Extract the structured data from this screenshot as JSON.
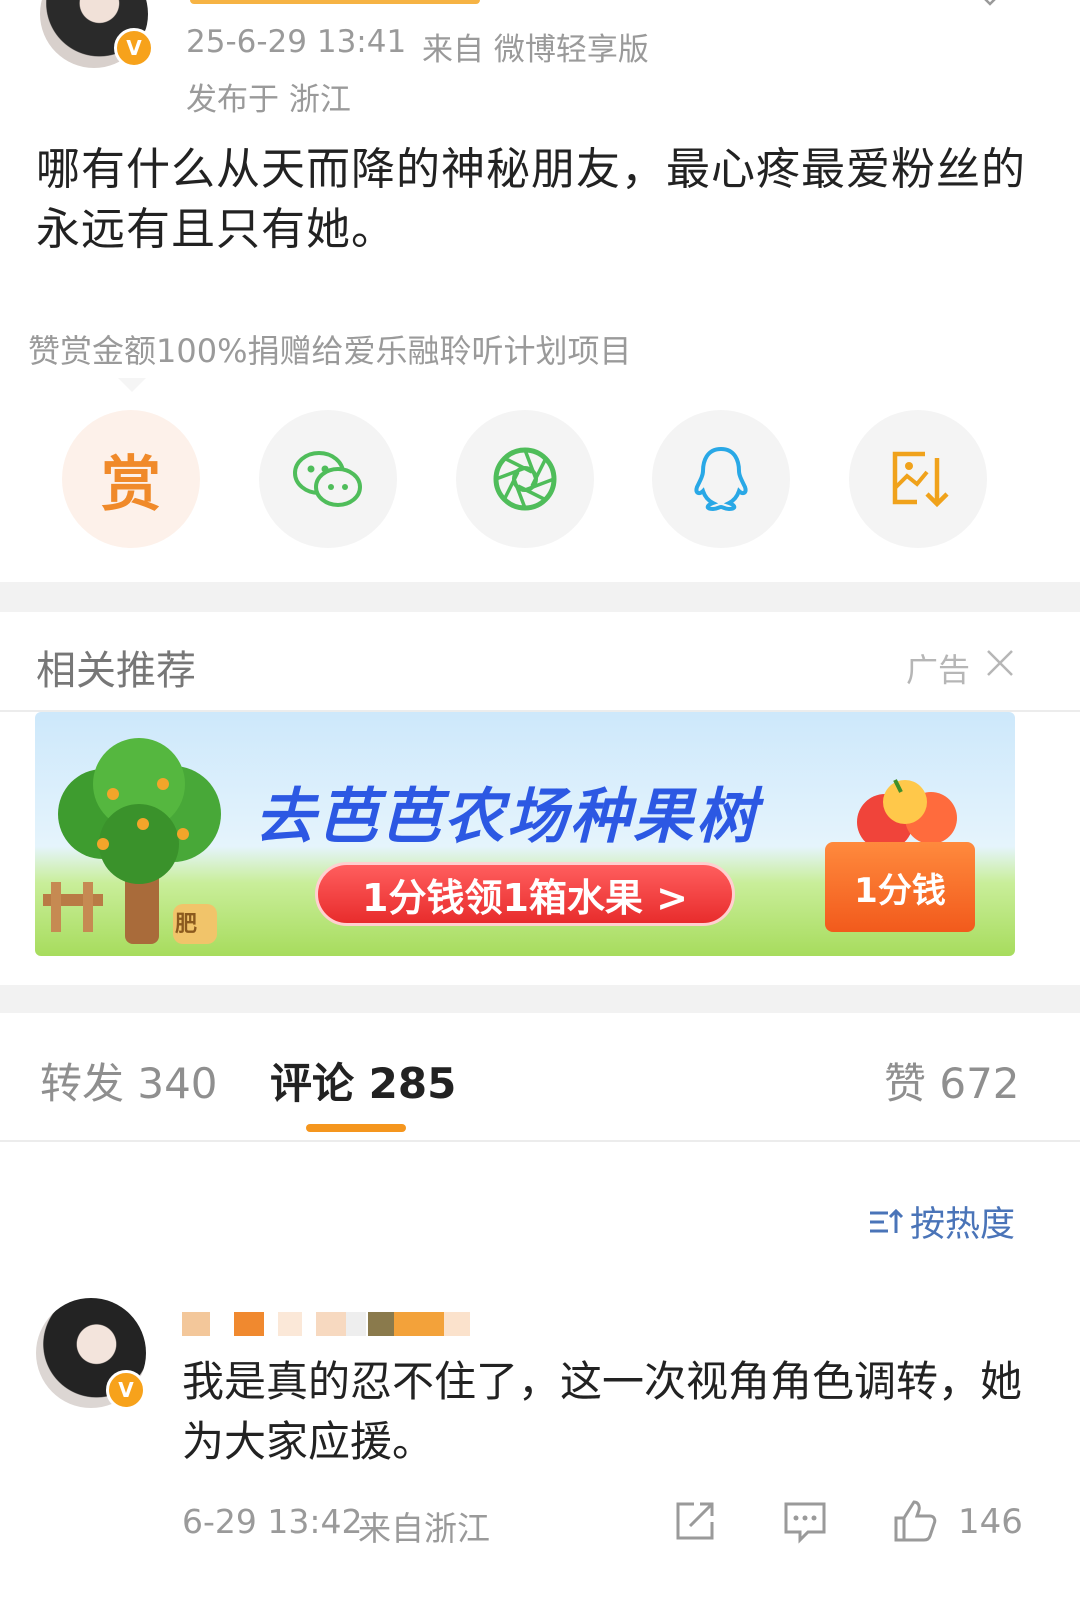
{
  "post": {
    "time": "25-6-29 13:41",
    "source": "来自 微博轻享版",
    "location": "发布于 浙江",
    "text": "哪有什么从天而降的神秘朋友，最心疼最爱粉丝的永远有且只有她。",
    "verified_badge": "V"
  },
  "donation": {
    "note": "赞赏金额100%捐赠给爱乐融聆听计划项目",
    "reward_label": "赏",
    "share_icons": [
      "reward-icon",
      "wechat-icon",
      "moments-icon",
      "qq-icon",
      "save-image-icon"
    ]
  },
  "recommend": {
    "title": "相关推荐",
    "ad_label": "广告"
  },
  "ad_banner": {
    "title": "去芭芭农场种果树",
    "cta": "1分钱领1箱水果 >",
    "box_label": "1分钱",
    "fertilizer_label": "肥"
  },
  "tabs": {
    "repost": "转发 340",
    "comments": "评论 285",
    "likes": "赞 672"
  },
  "sort": {
    "label": "按热度"
  },
  "comment": {
    "text": "我是真的忍不住了，这一次视角角色调转，她为大家应援。",
    "time": "6-29 13:42",
    "location": "来自浙江",
    "like_count": "146",
    "verified_badge": "V"
  },
  "colors": {
    "accent": "#f5961e",
    "reward": "#f08a2a",
    "wechat": "#4fbd5a",
    "qq": "#29a8e6",
    "save": "#f0a21b",
    "sort": "#4a74b8"
  }
}
